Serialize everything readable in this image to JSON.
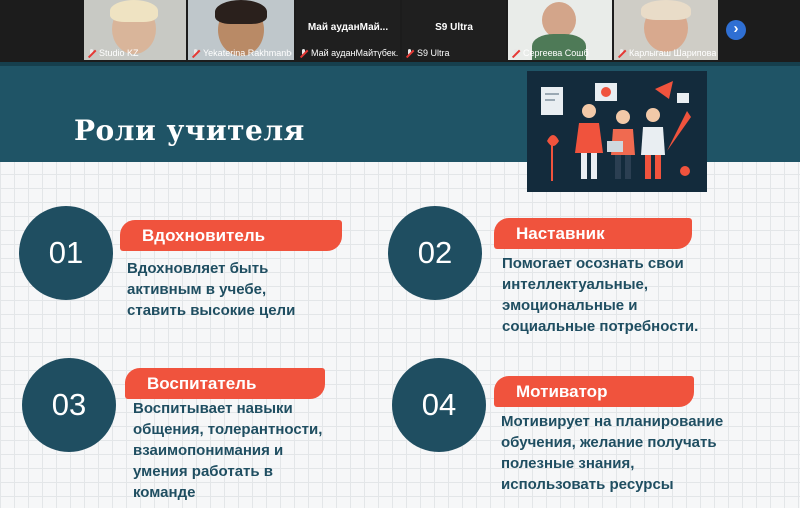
{
  "participants": [
    {
      "name": "Studio KZ",
      "type": "video"
    },
    {
      "name": "Yekaterina Rakhmanber...",
      "type": "video"
    },
    {
      "name": "Май ауданМайтүбек...",
      "type": "text",
      "text": "Май ауданМай..."
    },
    {
      "name": "S9 Ultra",
      "type": "text",
      "text": "S9 Ultra"
    },
    {
      "name": "Сергеева Сошб",
      "type": "video"
    },
    {
      "name": "Карлыгаш Шарипова",
      "type": "video"
    }
  ],
  "next_icon": "chevron-right-icon",
  "slide": {
    "title": "Роли учителя",
    "cards": [
      {
        "number": "01",
        "role": "Вдохновитель",
        "lines": [
          "Вдохновляет быть",
          "активным в учебе,",
          "ставить высокие цели"
        ]
      },
      {
        "number": "02",
        "role": "Наставник",
        "lines": [
          "Помогает осознать свои",
          "интеллектуальные,",
          "эмоциональные и",
          "социальные потребности."
        ]
      },
      {
        "number": "03",
        "role": "Воспитатель",
        "lines": [
          "Воспитывает навыки",
          "общения, толерантности,",
          "взаимопонимания и",
          "умения работать в",
          "команде"
        ]
      },
      {
        "number": "04",
        "role": "Мотиватор",
        "lines": [
          "Мотивирует на планирование",
          "обучения, желание получать",
          "полезные знания,",
          "использовать ресурсы"
        ]
      }
    ]
  },
  "colors": {
    "banner": "#1f5466",
    "accent": "#f0533d",
    "circle": "#1f4e61",
    "text": "#1f4e61"
  }
}
